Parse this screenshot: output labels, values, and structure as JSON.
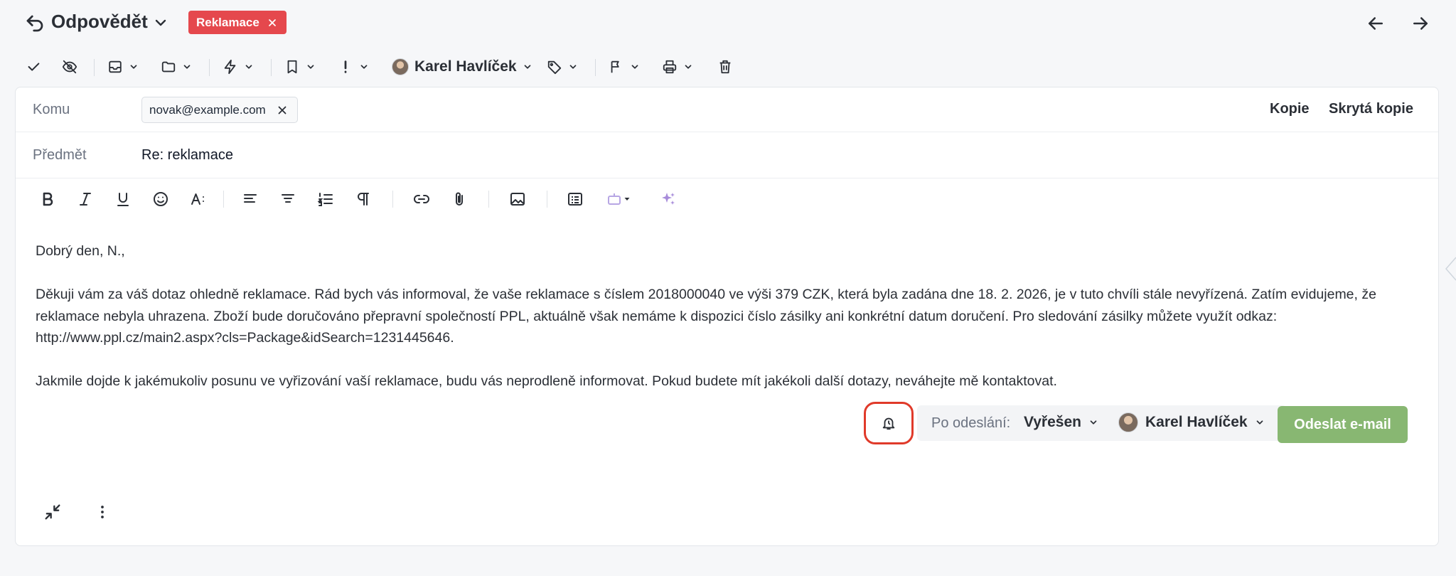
{
  "header": {
    "title": "Odpovědět",
    "tag": "Reklamace"
  },
  "toolbar": {
    "agent_name": "Karel Havlíček"
  },
  "compose": {
    "to_label": "Komu",
    "recipient": "novak@example.com",
    "cc_label": "Kopie",
    "bcc_label": "Skrytá kopie",
    "subject_label": "Předmět",
    "subject_value": "Re: reklamace",
    "body": {
      "greeting": "Dobrý den, N.,",
      "paragraph1": "Děkuji vám za váš dotaz ohledně reklamace. Rád bych vás informoval, že vaše reklamace s číslem 2018000040 ve výši 379 CZK, která byla zadána dne 18. 2. 2026, je v tuto chvíli stále nevyřízená. Zatím evidujeme, že reklamace nebyla uhrazena. Zboží bude doručováno přepravní společností PPL, aktuálně však nemáme k dispozici číslo zásilky ani konkrétní datum doručení. Pro sledování zásilky můžete využít odkaz: http://www.ppl.cz/main2.aspx?cls=Package&idSearch=1231445646.",
      "paragraph2": "Jakmile dojde k jakémukoliv posunu ve vyřizování vaší reklamace, budu vás neprodleně informovat. Pokud budete mít jakékoli další dotazy, neváhejte mě kontaktovat."
    }
  },
  "footer": {
    "after_send_label": "Po odeslání:",
    "status_value": "Vyřešen",
    "assignee": "Karel Havlíček",
    "send_label": "Odeslat e-mail"
  },
  "colors": {
    "tag_red": "#e5484d",
    "send_green": "#88b772",
    "highlight_ring": "#e03a2a",
    "ai_accent": "#a78bda"
  }
}
